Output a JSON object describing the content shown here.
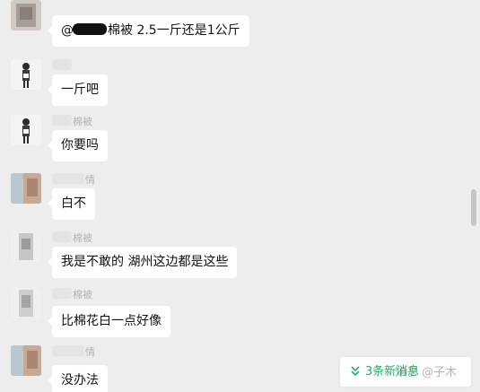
{
  "messages": [
    {
      "sender": "",
      "text_pre": "@",
      "text_post": "棉被 2.5一斤还是1公斤"
    },
    {
      "sender": "",
      "text": "一斤吧"
    },
    {
      "sender": "棉被",
      "text": "你要吗"
    },
    {
      "sender": "情",
      "text": "白不"
    },
    {
      "sender": "棉被",
      "text": "我是不敢的 湖州这边都是这些"
    },
    {
      "sender": "棉被",
      "text": "比棉花白一点好像"
    },
    {
      "sender": "情",
      "text": "没办法"
    }
  ],
  "new_messages": {
    "label": "3条新消息",
    "icon": "double-chevron-down-icon"
  },
  "watermark": "知乎 @子木",
  "colors": {
    "background": "#ededed",
    "bubble": "#ffffff",
    "accent": "#2aae67",
    "sender": "#b2b2b2"
  }
}
